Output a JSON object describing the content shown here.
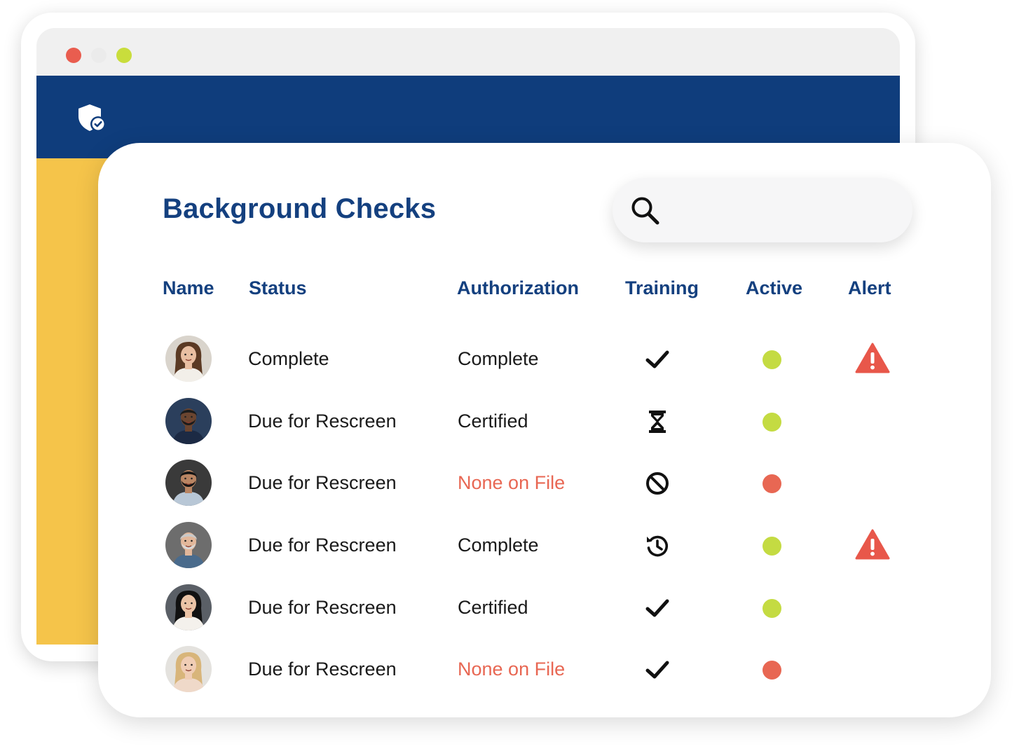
{
  "colors": {
    "header_blue": "#0f3d7c",
    "sidebar_yellow": "#f5c44a",
    "title_blue": "#14407f",
    "active_green": "#c4db42",
    "inactive_red": "#e86753",
    "warning_text": "#e86753",
    "traffic_red": "#e95d4f",
    "traffic_grey": "#ebebeb",
    "traffic_green": "#c9dd3c"
  },
  "browser": {
    "traffic_lights": [
      "close",
      "minimize",
      "maximize"
    ],
    "logo_icon": "shield-check-icon"
  },
  "page": {
    "title": "Background Checks",
    "search": {
      "placeholder": "",
      "value": "",
      "icon": "search-icon"
    }
  },
  "table": {
    "headers": {
      "name": "Name",
      "status": "Status",
      "authorization": "Authorization",
      "training": "Training",
      "active": "Active",
      "alert": "Alert"
    },
    "rows": [
      {
        "avatar": "woman-brown-hair",
        "status": "Complete",
        "authorization": "Complete",
        "authorization_warning": false,
        "training_icon": "checkmark-icon",
        "active": true,
        "alert": true
      },
      {
        "avatar": "man-beard-navy",
        "status": "Due for Rescreen",
        "authorization": "Certified",
        "authorization_warning": false,
        "training_icon": "hourglass-icon",
        "active": true,
        "alert": false
      },
      {
        "avatar": "man-dark-hair",
        "status": "Due for Rescreen",
        "authorization": "None on File",
        "authorization_warning": true,
        "training_icon": "ban-icon",
        "active": false,
        "alert": false
      },
      {
        "avatar": "man-grey-hair",
        "status": "Due for Rescreen",
        "authorization": "Complete",
        "authorization_warning": false,
        "training_icon": "history-icon",
        "active": true,
        "alert": true
      },
      {
        "avatar": "woman-black-hair",
        "status": "Due for Rescreen",
        "authorization": "Certified",
        "authorization_warning": false,
        "training_icon": "checkmark-icon",
        "active": true,
        "alert": false
      },
      {
        "avatar": "woman-blonde-hair",
        "status": "Due for Rescreen",
        "authorization": "None on File",
        "authorization_warning": true,
        "training_icon": "checkmark-icon",
        "active": false,
        "alert": false
      }
    ]
  }
}
